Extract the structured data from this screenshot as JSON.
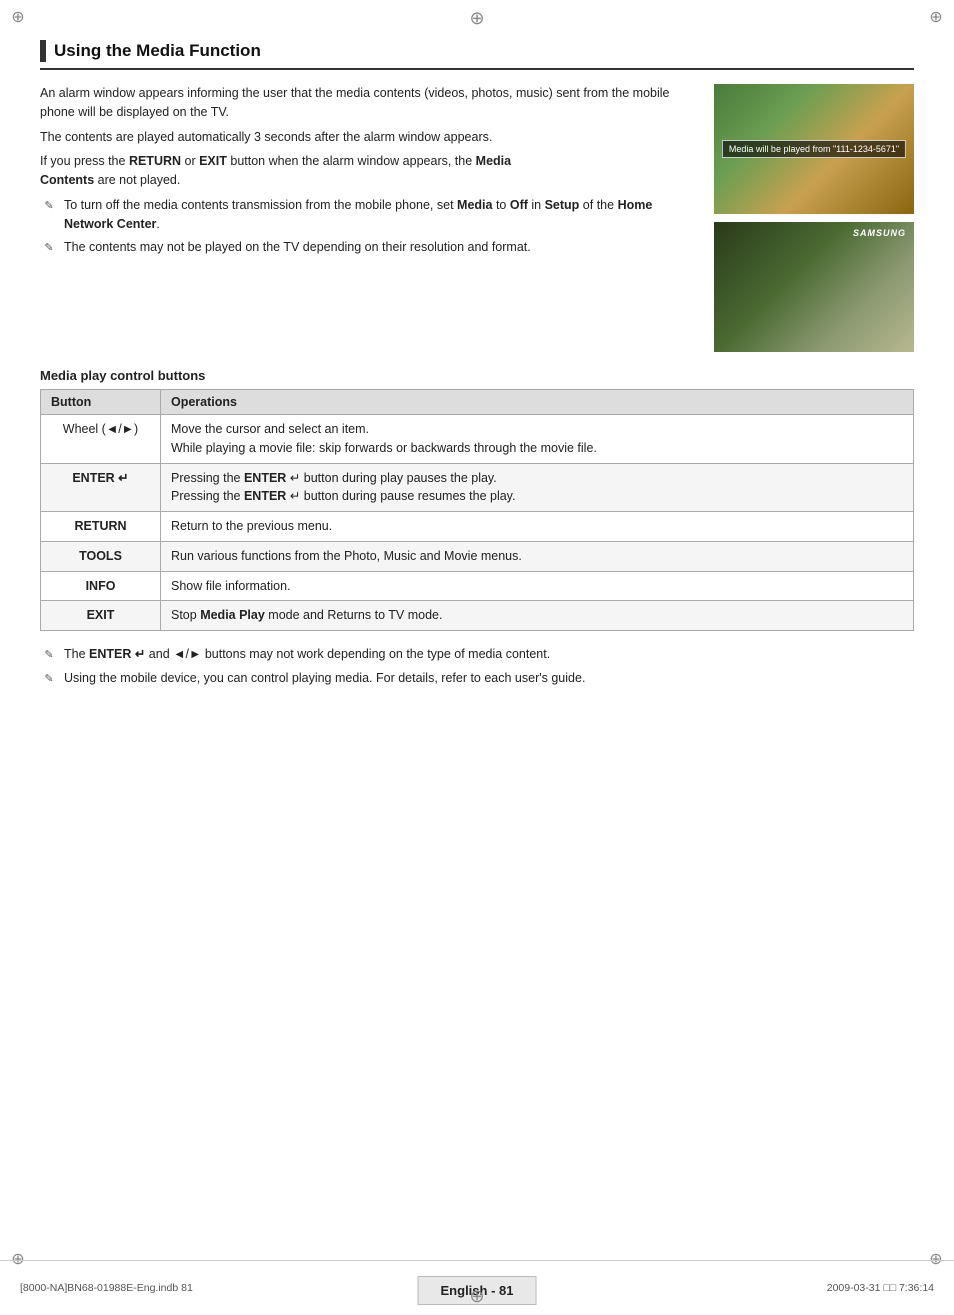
{
  "page": {
    "title": "Using the Media Function",
    "page_number_label": "English - 81",
    "footer_left": "[8000-NA]BN68-01988E-Eng.indb   81",
    "footer_right": "2009-03-31   □□ 7:36:14"
  },
  "intro": {
    "para1": "An alarm window appears informing the user that the media contents (videos, photos, music) sent from the mobile phone will be displayed on the TV.",
    "para2": "The contents are played automatically 3 seconds after the alarm window appears.",
    "para3_prefix": "If you press the ",
    "para3_return": "RETURN",
    "para3_mid": " or ",
    "para3_exit": "EXIT",
    "para3_mid2": " button when the alarm window appears, the ",
    "para3_media": "Media",
    "para3_suffix": " ",
    "para3_contents": "Contents",
    "para3_end": " are not played."
  },
  "notes": [
    {
      "text_prefix": "To turn off the media contents transmission from the mobile phone, set ",
      "bold1": "Media",
      "text_mid": " to ",
      "bold2": "Off",
      "text_mid2": " in ",
      "bold3": "Setup",
      "text_mid3": " of the ",
      "bold4": "Home Network Center",
      "text_end": "."
    },
    {
      "text": "The contents may not be played on the TV depending on their resolution and format."
    }
  ],
  "images": {
    "image1_overlay": "Media will be played from \"111-1234-5671\"",
    "image2_samsung": "SAMSUNG"
  },
  "table": {
    "heading": "Media play control buttons",
    "col_button": "Button",
    "col_operations": "Operations",
    "rows": [
      {
        "button": "Wheel (◄/►)",
        "operations": "Move the cursor and select an item.\nWhile playing a movie file: skip forwards or backwards through the movie file."
      },
      {
        "button": "ENTER ↵",
        "operations": "Pressing the ENTER ↵ button during play pauses the play.\nPressing the ENTER ↵ button during pause resumes the play."
      },
      {
        "button": "RETURN",
        "operations": "Return to the previous menu."
      },
      {
        "button": "TOOLS",
        "operations": "Run various functions from the Photo, Music and Movie menus."
      },
      {
        "button": "INFO",
        "operations": "Show file information."
      },
      {
        "button": "EXIT",
        "operations": "Stop Media Play mode and Returns to TV mode."
      }
    ]
  },
  "bottom_notes": [
    {
      "text_prefix": "The ",
      "bold1": "ENTER ↵",
      "text_mid": " and ◄/► buttons may not work depending on the type of media content."
    },
    {
      "text": "Using the mobile device, you can control playing media. For details, refer to each user's guide."
    }
  ]
}
